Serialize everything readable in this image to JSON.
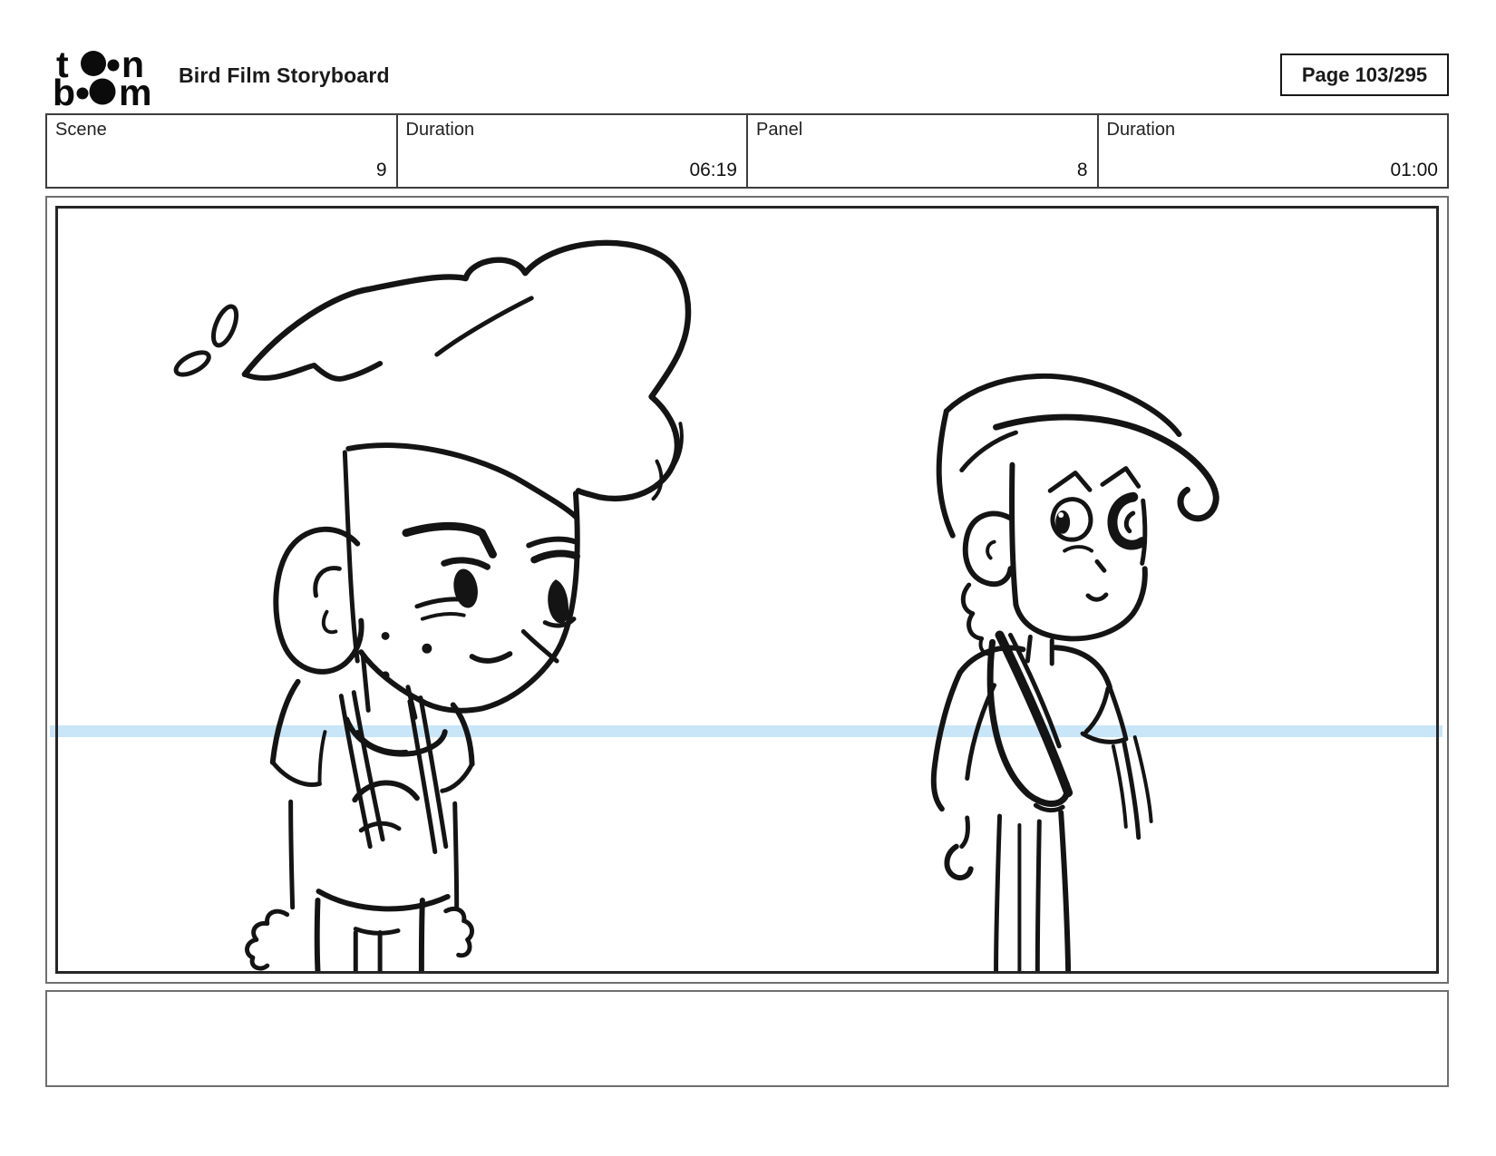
{
  "header": {
    "title": "Bird Film Storyboard",
    "page_label": "Page 103/295",
    "logo_letters": {
      "row1_first": "t",
      "row1_last": "n",
      "row2_first": "b",
      "row2_last": "m"
    }
  },
  "info_table": {
    "cells": [
      {
        "label": "Scene",
        "value": "9"
      },
      {
        "label": "Duration",
        "value": "06:19"
      },
      {
        "label": "Panel",
        "value": "8"
      },
      {
        "label": "Duration",
        "value": "01:00"
      }
    ]
  },
  "panel": {
    "guide_line_color": "#c8e6f8",
    "ink_color": "#141414",
    "sketch_description": "Hand-drawn storyboard sketch: annoyed boy with large swooped hair and backpack straps on the left, smaller robed figure with cap looking at him on the right; both cut off at the frame bottom"
  },
  "caption": {
    "text": ""
  }
}
